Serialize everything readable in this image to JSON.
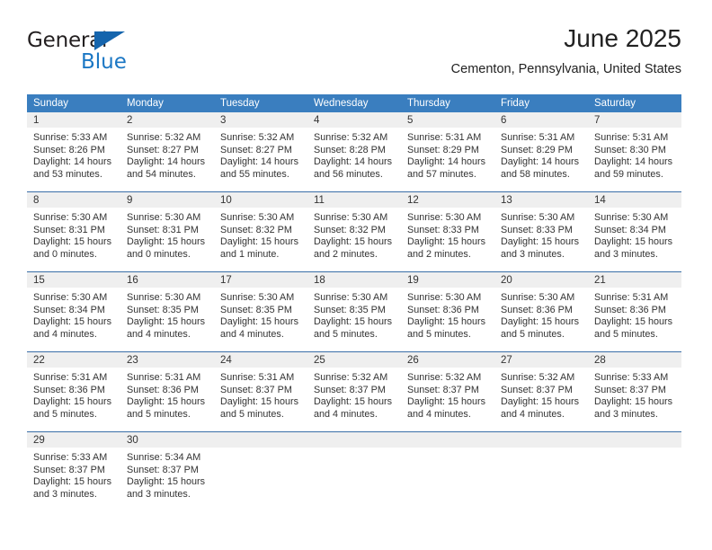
{
  "brand": {
    "name_part1": "General",
    "name_part2": "Blue",
    "triangle_icon": "triangle-icon",
    "accent_color": "#1b77c4"
  },
  "header": {
    "title": "June 2025",
    "location": "Cementon, Pennsylvania, United States"
  },
  "colors": {
    "header_blue": "#3a7ebf",
    "row_divider_blue": "#3a6fa8",
    "daynum_band_gray": "#efefef",
    "text": "#333333"
  },
  "weekday_headers": [
    "Sunday",
    "Monday",
    "Tuesday",
    "Wednesday",
    "Thursday",
    "Friday",
    "Saturday"
  ],
  "weeks": [
    [
      {
        "day": "1",
        "sunrise": "Sunrise: 5:33 AM",
        "sunset": "Sunset: 8:26 PM",
        "daylight_line1": "Daylight: 14 hours",
        "daylight_line2": "and 53 minutes."
      },
      {
        "day": "2",
        "sunrise": "Sunrise: 5:32 AM",
        "sunset": "Sunset: 8:27 PM",
        "daylight_line1": "Daylight: 14 hours",
        "daylight_line2": "and 54 minutes."
      },
      {
        "day": "3",
        "sunrise": "Sunrise: 5:32 AM",
        "sunset": "Sunset: 8:27 PM",
        "daylight_line1": "Daylight: 14 hours",
        "daylight_line2": "and 55 minutes."
      },
      {
        "day": "4",
        "sunrise": "Sunrise: 5:32 AM",
        "sunset": "Sunset: 8:28 PM",
        "daylight_line1": "Daylight: 14 hours",
        "daylight_line2": "and 56 minutes."
      },
      {
        "day": "5",
        "sunrise": "Sunrise: 5:31 AM",
        "sunset": "Sunset: 8:29 PM",
        "daylight_line1": "Daylight: 14 hours",
        "daylight_line2": "and 57 minutes."
      },
      {
        "day": "6",
        "sunrise": "Sunrise: 5:31 AM",
        "sunset": "Sunset: 8:29 PM",
        "daylight_line1": "Daylight: 14 hours",
        "daylight_line2": "and 58 minutes."
      },
      {
        "day": "7",
        "sunrise": "Sunrise: 5:31 AM",
        "sunset": "Sunset: 8:30 PM",
        "daylight_line1": "Daylight: 14 hours",
        "daylight_line2": "and 59 minutes."
      }
    ],
    [
      {
        "day": "8",
        "sunrise": "Sunrise: 5:30 AM",
        "sunset": "Sunset: 8:31 PM",
        "daylight_line1": "Daylight: 15 hours",
        "daylight_line2": "and 0 minutes."
      },
      {
        "day": "9",
        "sunrise": "Sunrise: 5:30 AM",
        "sunset": "Sunset: 8:31 PM",
        "daylight_line1": "Daylight: 15 hours",
        "daylight_line2": "and 0 minutes."
      },
      {
        "day": "10",
        "sunrise": "Sunrise: 5:30 AM",
        "sunset": "Sunset: 8:32 PM",
        "daylight_line1": "Daylight: 15 hours",
        "daylight_line2": "and 1 minute."
      },
      {
        "day": "11",
        "sunrise": "Sunrise: 5:30 AM",
        "sunset": "Sunset: 8:32 PM",
        "daylight_line1": "Daylight: 15 hours",
        "daylight_line2": "and 2 minutes."
      },
      {
        "day": "12",
        "sunrise": "Sunrise: 5:30 AM",
        "sunset": "Sunset: 8:33 PM",
        "daylight_line1": "Daylight: 15 hours",
        "daylight_line2": "and 2 minutes."
      },
      {
        "day": "13",
        "sunrise": "Sunrise: 5:30 AM",
        "sunset": "Sunset: 8:33 PM",
        "daylight_line1": "Daylight: 15 hours",
        "daylight_line2": "and 3 minutes."
      },
      {
        "day": "14",
        "sunrise": "Sunrise: 5:30 AM",
        "sunset": "Sunset: 8:34 PM",
        "daylight_line1": "Daylight: 15 hours",
        "daylight_line2": "and 3 minutes."
      }
    ],
    [
      {
        "day": "15",
        "sunrise": "Sunrise: 5:30 AM",
        "sunset": "Sunset: 8:34 PM",
        "daylight_line1": "Daylight: 15 hours",
        "daylight_line2": "and 4 minutes."
      },
      {
        "day": "16",
        "sunrise": "Sunrise: 5:30 AM",
        "sunset": "Sunset: 8:35 PM",
        "daylight_line1": "Daylight: 15 hours",
        "daylight_line2": "and 4 minutes."
      },
      {
        "day": "17",
        "sunrise": "Sunrise: 5:30 AM",
        "sunset": "Sunset: 8:35 PM",
        "daylight_line1": "Daylight: 15 hours",
        "daylight_line2": "and 4 minutes."
      },
      {
        "day": "18",
        "sunrise": "Sunrise: 5:30 AM",
        "sunset": "Sunset: 8:35 PM",
        "daylight_line1": "Daylight: 15 hours",
        "daylight_line2": "and 5 minutes."
      },
      {
        "day": "19",
        "sunrise": "Sunrise: 5:30 AM",
        "sunset": "Sunset: 8:36 PM",
        "daylight_line1": "Daylight: 15 hours",
        "daylight_line2": "and 5 minutes."
      },
      {
        "day": "20",
        "sunrise": "Sunrise: 5:30 AM",
        "sunset": "Sunset: 8:36 PM",
        "daylight_line1": "Daylight: 15 hours",
        "daylight_line2": "and 5 minutes."
      },
      {
        "day": "21",
        "sunrise": "Sunrise: 5:31 AM",
        "sunset": "Sunset: 8:36 PM",
        "daylight_line1": "Daylight: 15 hours",
        "daylight_line2": "and 5 minutes."
      }
    ],
    [
      {
        "day": "22",
        "sunrise": "Sunrise: 5:31 AM",
        "sunset": "Sunset: 8:36 PM",
        "daylight_line1": "Daylight: 15 hours",
        "daylight_line2": "and 5 minutes."
      },
      {
        "day": "23",
        "sunrise": "Sunrise: 5:31 AM",
        "sunset": "Sunset: 8:36 PM",
        "daylight_line1": "Daylight: 15 hours",
        "daylight_line2": "and 5 minutes."
      },
      {
        "day": "24",
        "sunrise": "Sunrise: 5:31 AM",
        "sunset": "Sunset: 8:37 PM",
        "daylight_line1": "Daylight: 15 hours",
        "daylight_line2": "and 5 minutes."
      },
      {
        "day": "25",
        "sunrise": "Sunrise: 5:32 AM",
        "sunset": "Sunset: 8:37 PM",
        "daylight_line1": "Daylight: 15 hours",
        "daylight_line2": "and 4 minutes."
      },
      {
        "day": "26",
        "sunrise": "Sunrise: 5:32 AM",
        "sunset": "Sunset: 8:37 PM",
        "daylight_line1": "Daylight: 15 hours",
        "daylight_line2": "and 4 minutes."
      },
      {
        "day": "27",
        "sunrise": "Sunrise: 5:32 AM",
        "sunset": "Sunset: 8:37 PM",
        "daylight_line1": "Daylight: 15 hours",
        "daylight_line2": "and 4 minutes."
      },
      {
        "day": "28",
        "sunrise": "Sunrise: 5:33 AM",
        "sunset": "Sunset: 8:37 PM",
        "daylight_line1": "Daylight: 15 hours",
        "daylight_line2": "and 3 minutes."
      }
    ],
    [
      {
        "day": "29",
        "sunrise": "Sunrise: 5:33 AM",
        "sunset": "Sunset: 8:37 PM",
        "daylight_line1": "Daylight: 15 hours",
        "daylight_line2": "and 3 minutes."
      },
      {
        "day": "30",
        "sunrise": "Sunrise: 5:34 AM",
        "sunset": "Sunset: 8:37 PM",
        "daylight_line1": "Daylight: 15 hours",
        "daylight_line2": "and 3 minutes."
      },
      {
        "day": "",
        "sunrise": "",
        "sunset": "",
        "daylight_line1": "",
        "daylight_line2": ""
      },
      {
        "day": "",
        "sunrise": "",
        "sunset": "",
        "daylight_line1": "",
        "daylight_line2": ""
      },
      {
        "day": "",
        "sunrise": "",
        "sunset": "",
        "daylight_line1": "",
        "daylight_line2": ""
      },
      {
        "day": "",
        "sunrise": "",
        "sunset": "",
        "daylight_line1": "",
        "daylight_line2": ""
      },
      {
        "day": "",
        "sunrise": "",
        "sunset": "",
        "daylight_line1": "",
        "daylight_line2": ""
      }
    ]
  ]
}
